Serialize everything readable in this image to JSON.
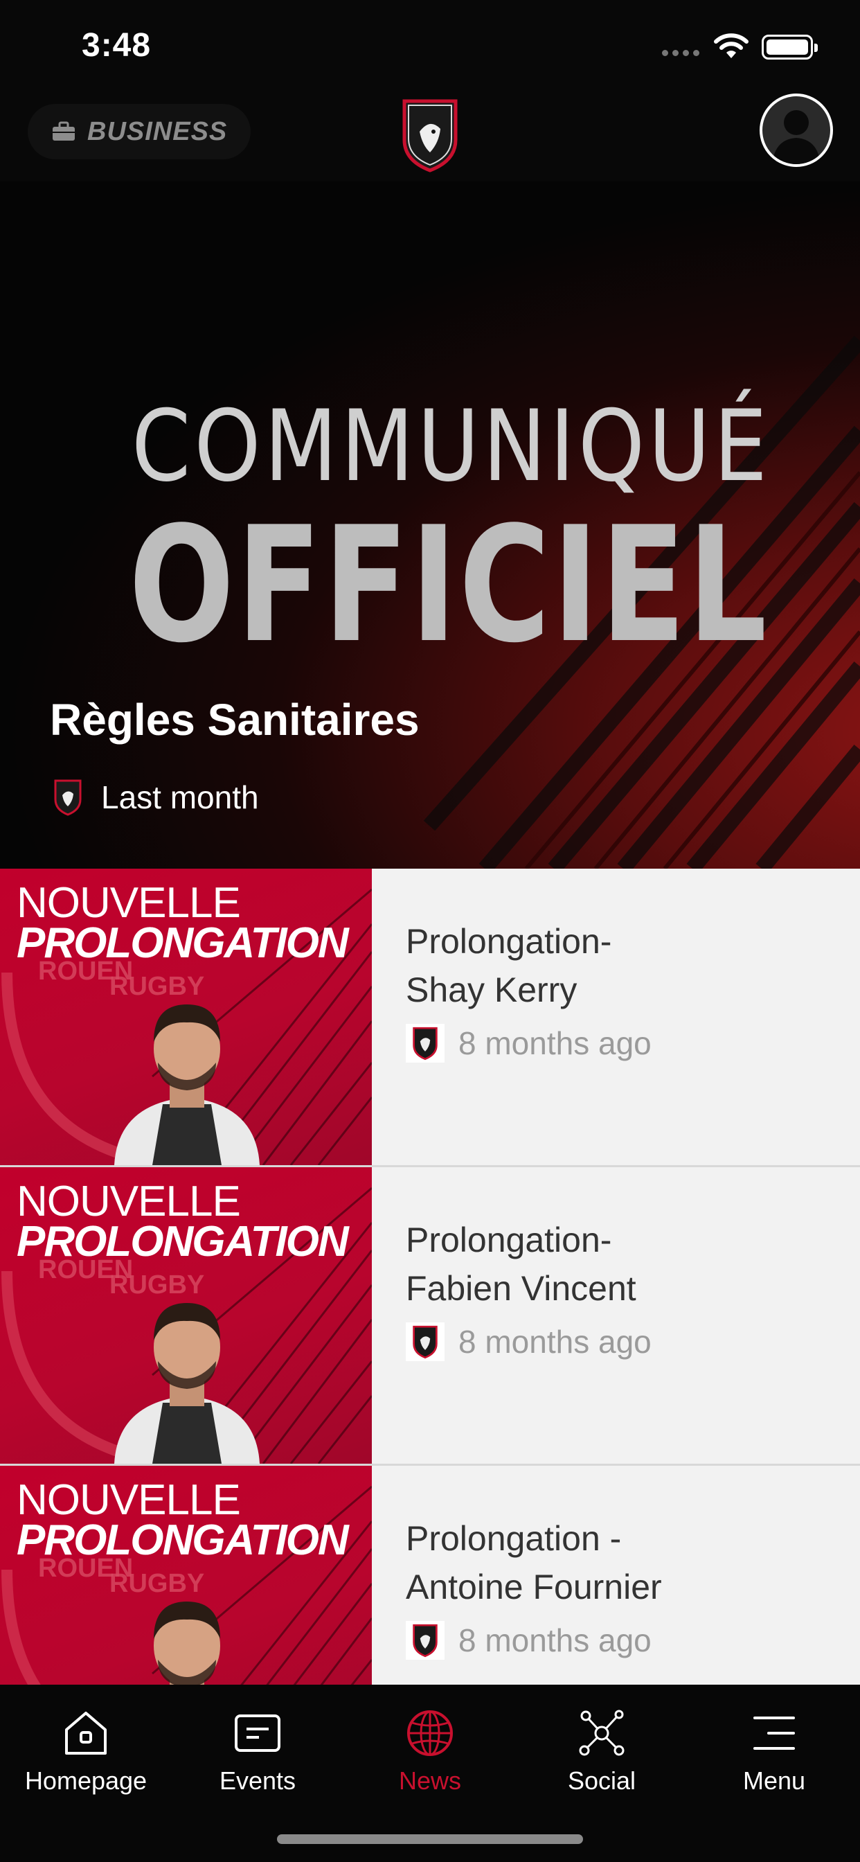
{
  "status_bar": {
    "time": "3:48"
  },
  "header": {
    "business_label": "BUSINESS",
    "logo_text": "ROUEN NORMANDIE RUGBY"
  },
  "hero": {
    "banner_line1": "COMMUNIQUÉ",
    "banner_line2": "OFFICIEL",
    "title": "Règles Sanitaires",
    "time": "Last month"
  },
  "news": [
    {
      "thumb_line1": "NOUVELLE",
      "thumb_line2": "PROLONGATION",
      "thumb_brand": "RUGBY",
      "title_line1": "Prolongation-",
      "title_line2": "Shay Kerry",
      "time": "8 months ago"
    },
    {
      "thumb_line1": "NOUVELLE",
      "thumb_line2": "PROLONGATION",
      "thumb_brand": "RUGBY",
      "title_line1": "Prolongation-",
      "title_line2": "Fabien Vincent",
      "time": "8 months ago"
    },
    {
      "thumb_line1": "NOUVELLE",
      "thumb_line2": "PROLONGATION",
      "thumb_brand": "RUGBY",
      "title_line1": "Prolongation -",
      "title_line2": "Antoine Fournier",
      "time": "8 months ago"
    }
  ],
  "tab_bar": {
    "items": [
      {
        "label": "Homepage",
        "icon": "home-icon"
      },
      {
        "label": "Events",
        "icon": "events-icon"
      },
      {
        "label": "News",
        "icon": "globe-icon"
      },
      {
        "label": "Social",
        "icon": "social-network-icon"
      },
      {
        "label": "Menu",
        "icon": "menu-icon"
      }
    ],
    "active": "News",
    "active_color": "#c8102e"
  }
}
